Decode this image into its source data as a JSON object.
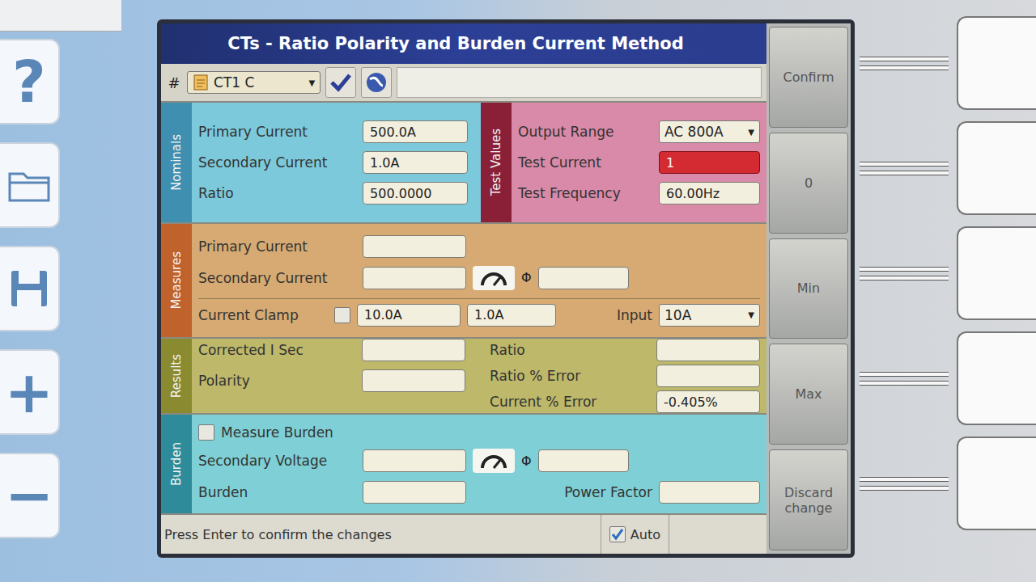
{
  "title": "CTs - Ratio Polarity and Burden Current Method",
  "toolbar": {
    "hash": "#",
    "test": {
      "value": "CT1 C"
    }
  },
  "nominals": {
    "label": "Nominals",
    "rows": [
      {
        "label": "Primary Current",
        "value": "500.0A"
      },
      {
        "label": "Secondary Current",
        "value": "1.0A"
      },
      {
        "label": "Ratio",
        "value": "500.0000"
      }
    ]
  },
  "test_values": {
    "label": "Test Values",
    "output_range": {
      "label": "Output Range",
      "value": "AC 800A"
    },
    "test_current": {
      "label": "Test Current",
      "value": "1"
    },
    "test_frequency": {
      "label": "Test Frequency",
      "value": "60.00Hz"
    }
  },
  "measures": {
    "label": "Measures",
    "primary_current": {
      "label": "Primary Current"
    },
    "secondary_current": {
      "label": "Secondary Current",
      "phase_symbol": "Φ"
    },
    "current_clamp": {
      "label": "Current Clamp",
      "checked": false,
      "range": "10.0A",
      "secondary": "1.0A"
    },
    "input": {
      "label": "Input",
      "value": "10A"
    }
  },
  "results": {
    "label": "Results",
    "corrected_i_sec": {
      "label": "Corrected I Sec"
    },
    "polarity": {
      "label": "Polarity"
    },
    "ratio": {
      "label": "Ratio"
    },
    "ratio_error": {
      "label": "Ratio % Error"
    },
    "current_error": {
      "label": "Current % Error",
      "value": "-0.405%"
    }
  },
  "burden": {
    "label": "Burden",
    "measure_burden": {
      "label": "Measure Burden",
      "checked": false
    },
    "secondary_voltage": {
      "label": "Secondary Voltage",
      "phase_symbol": "Φ"
    },
    "burden": {
      "label": "Burden"
    },
    "power_factor": {
      "label": "Power Factor"
    }
  },
  "status_bar": {
    "message": "Press Enter to confirm the changes",
    "auto": {
      "label": "Auto",
      "checked": true
    }
  },
  "softkeys": [
    {
      "label": "Confirm"
    },
    {
      "label": "0"
    },
    {
      "label": "Min"
    },
    {
      "label": "Max"
    },
    {
      "label": "Discard change"
    }
  ],
  "side_keys": [
    {
      "kind": "glyph",
      "label": "?"
    },
    {
      "kind": "folder"
    },
    {
      "kind": "save"
    },
    {
      "kind": "glyph",
      "label": "+"
    },
    {
      "kind": "glyph",
      "label": "−"
    }
  ]
}
